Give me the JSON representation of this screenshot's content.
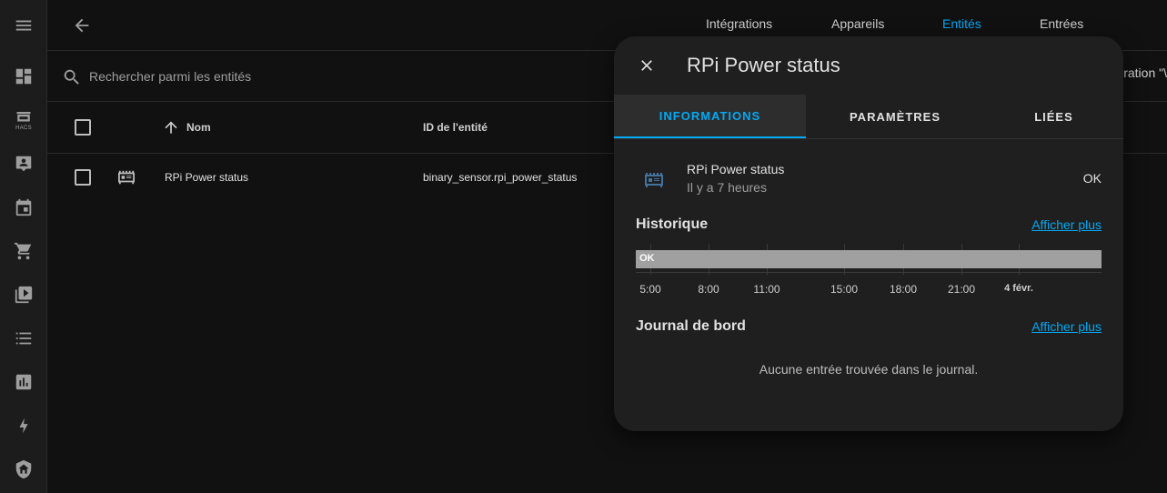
{
  "sidebar": {
    "items": [
      {
        "icon": "menu-icon"
      },
      {
        "icon": "dashboard-icon"
      },
      {
        "icon": "hacs-store-icon",
        "label": "HACS"
      },
      {
        "icon": "account-box-icon"
      },
      {
        "icon": "calendar-icon"
      },
      {
        "icon": "cart-icon"
      },
      {
        "icon": "play-box-icon"
      },
      {
        "icon": "format-list-icon"
      },
      {
        "icon": "chart-box-icon"
      },
      {
        "icon": "lightning-icon"
      },
      {
        "icon": "shield-home-icon"
      }
    ]
  },
  "topbar": {
    "tabs": [
      {
        "label": "Intégrations"
      },
      {
        "label": "Appareils"
      },
      {
        "label": "Entités",
        "active": true
      },
      {
        "label": "Entrées"
      }
    ]
  },
  "search": {
    "placeholder": "Rechercher parmi les entités",
    "config_label": "ration \"\\"
  },
  "table": {
    "headers": {
      "name": "Nom",
      "entity_id": "ID de l'entité"
    },
    "rows": [
      {
        "name": "RPi Power status",
        "entity_id": "binary_sensor.rpi_power_status"
      }
    ]
  },
  "dialog": {
    "title": "RPi Power status",
    "tabs": [
      {
        "label": "INFORMATIONS",
        "active": true
      },
      {
        "label": "PARAMÈTRES"
      },
      {
        "label": "LIÉES"
      }
    ],
    "state": {
      "name": "RPi Power status",
      "last_changed": "Il y a 7 heures",
      "value": "OK"
    },
    "history": {
      "title": "Historique",
      "more_label": "Afficher plus",
      "bar_label": "OK",
      "ticks": [
        "5:00",
        "8:00",
        "11:00",
        "15:00",
        "18:00",
        "21:00",
        "4 févr."
      ]
    },
    "logbook": {
      "title": "Journal de bord",
      "more_label": "Afficher plus",
      "empty_text": "Aucune entrée trouvée dans le journal."
    }
  },
  "colors": {
    "accent": "#03a9f4",
    "background": "#111111",
    "dialog": "#1f1f1f",
    "timeline_bar": "#a0a0a0"
  }
}
